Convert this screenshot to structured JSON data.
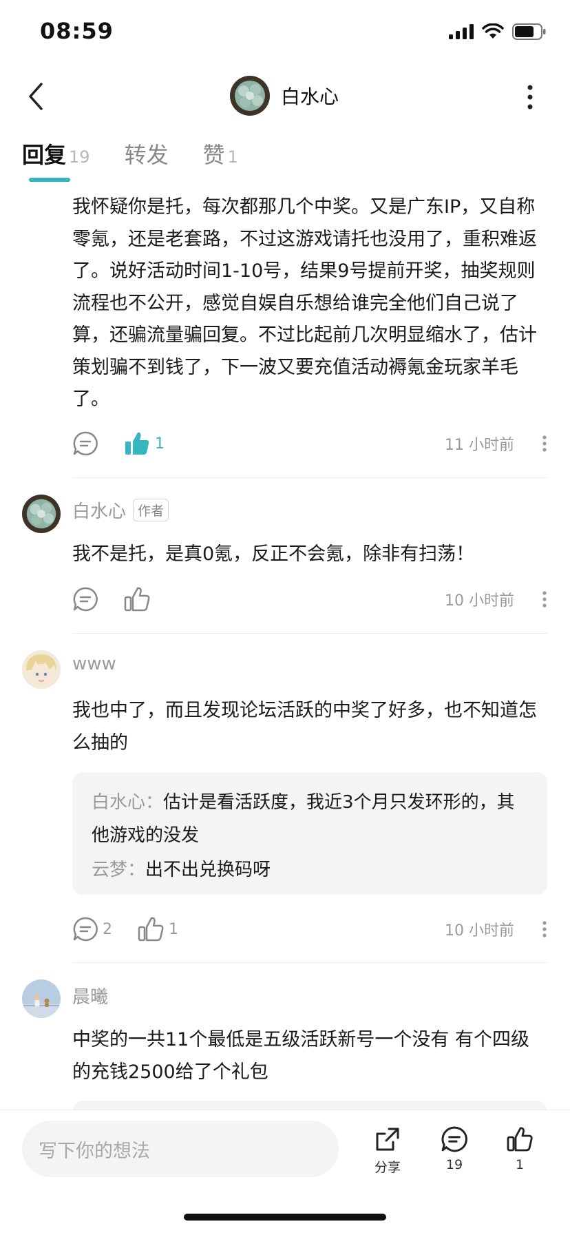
{
  "status_bar": {
    "time": "08:59",
    "battery_level": 0.75
  },
  "header": {
    "author_name": "白水心"
  },
  "tabs": [
    {
      "label": "回复",
      "count": "19",
      "active": true
    },
    {
      "label": "转发",
      "count": "",
      "active": false
    },
    {
      "label": "赞",
      "count": "1",
      "active": false
    }
  ],
  "comments": [
    {
      "text": "我怀疑你是托，每次都那几个中奖。又是广东IP，又自称零氪，还是老套路，不过这游戏请托也没用了，重积难返了。说好活动时间1-10号，结果9号提前开奖，抽奖规则流程也不公开，感觉自娱自乐想给谁完全他们自己说了算，还骗流量骗回复。不过比起前几次明显缩水了，估计策划骗不到钱了，下一波又要充值活动褥氪金玩家羊毛了。",
      "likes": "1",
      "time": "11 小时前"
    },
    {
      "name": "白水心",
      "badge": "作者",
      "text": "我不是托，是真0氪，反正不会氪，除非有扫荡！",
      "time": "10 小时前"
    },
    {
      "name": "www",
      "text": "我也中了，而且发现论坛活跃的中奖了好多，也不知道怎么抽的",
      "replies": [
        {
          "name": "白水心",
          "sep": "：",
          "text": "估计是看活跃度，我近3个月只发环形的，其他游戏的没发"
        },
        {
          "name": "云梦",
          "sep": "：",
          "text": "出不出兑换码呀"
        }
      ],
      "reply_count": "2",
      "likes": "1",
      "time": "10 小时前"
    },
    {
      "name": "晨曦",
      "text": "中奖的一共11个最低是五级活跃新号一个没有 有个四级的充钱2500给了个礼包"
    }
  ],
  "bottom_bar": {
    "input_placeholder": "写下你的想法",
    "share_label": "分享",
    "comment_count": "19",
    "like_count": "1"
  },
  "colors": {
    "accent": "#35b6c1",
    "muted": "#999999",
    "reply_bg": "#f3f4f6"
  }
}
